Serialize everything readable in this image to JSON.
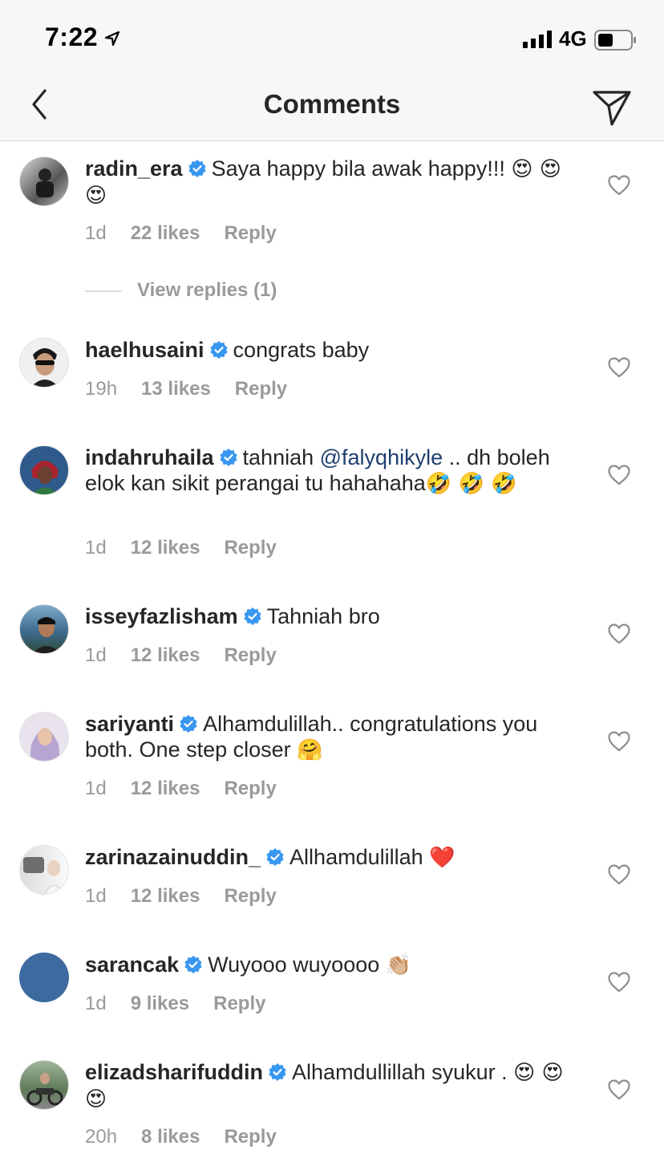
{
  "status": {
    "time": "7:22",
    "network": "4G"
  },
  "header": {
    "title": "Comments"
  },
  "comments": [
    {
      "username": "radin_era",
      "parts": [
        "Saya happy bila awak happy!!! ",
        "😍 😍 😍"
      ],
      "time": "1d",
      "likes": "22 likes",
      "reply": "Reply",
      "view_replies": "View replies (1)"
    },
    {
      "username": "haelhusaini",
      "parts": [
        "congrats baby"
      ],
      "time": "19h",
      "likes": "13 likes",
      "reply": "Reply"
    },
    {
      "username": "indahruhaila",
      "parts": [
        "tahniah ",
        "@falyqhikyle",
        " .. dh boleh elok kan sikit perangai tu hahahaha",
        "🤣 🤣 🤣"
      ],
      "time": "1d",
      "likes": "12 likes",
      "reply": "Reply"
    },
    {
      "username": "isseyfazlisham",
      "parts": [
        "Tahniah bro"
      ],
      "time": "1d",
      "likes": "12 likes",
      "reply": "Reply"
    },
    {
      "username": "sariyanti",
      "parts": [
        "Alhamdulillah.. congratulations you both. One step closer ",
        "🤗"
      ],
      "time": "1d",
      "likes": "12 likes",
      "reply": "Reply"
    },
    {
      "username": "zarinazainuddin_",
      "parts": [
        "Allhamdulillah ",
        "❤️"
      ],
      "time": "1d",
      "likes": "12 likes",
      "reply": "Reply"
    },
    {
      "username": "sarancak",
      "parts": [
        "Wuyooo wuyoooo ",
        "👏🏼"
      ],
      "time": "1d",
      "likes": "9 likes",
      "reply": "Reply"
    },
    {
      "username": "elizadsharifuddin",
      "parts": [
        "Alhamdullillah syukur . ",
        "😍 😍 😍"
      ],
      "time": "20h",
      "likes": "8 likes",
      "reply": "Reply"
    }
  ],
  "colors": {
    "accent_blue": "#3897f0",
    "mention": "#1e3f6e",
    "meta_gray": "#9a9a9a",
    "text": "#262626"
  }
}
